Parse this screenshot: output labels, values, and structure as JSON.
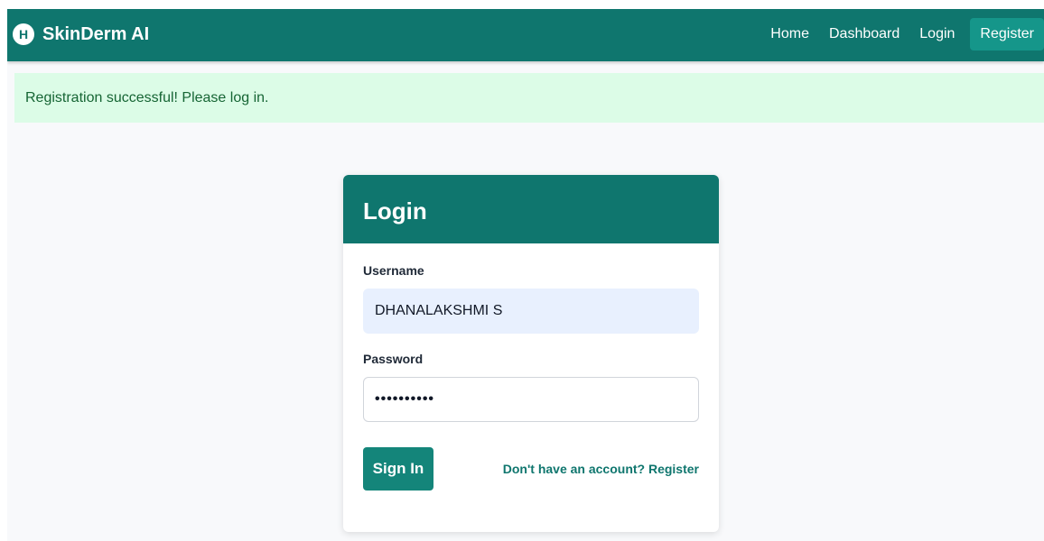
{
  "navbar": {
    "brand_logo_letter": "H",
    "brand_name": "SkinDerm AI",
    "links": [
      {
        "label": "Home"
      },
      {
        "label": "Dashboard"
      },
      {
        "label": "Login"
      },
      {
        "label": "Register"
      }
    ]
  },
  "alert": {
    "message": "Registration successful! Please log in."
  },
  "login_card": {
    "title": "Login",
    "username": {
      "label": "Username",
      "value": "DHANALAKSHMI S"
    },
    "password": {
      "label": "Password",
      "value": "••••••••••"
    },
    "signin_label": "Sign In",
    "register_prompt": "Don't have an account? Register"
  },
  "colors": {
    "primary": "#0f766e",
    "button": "#14857a",
    "alert_bg": "#dcfce7",
    "alert_text": "#166534",
    "autofill_bg": "#e8f0fe"
  }
}
